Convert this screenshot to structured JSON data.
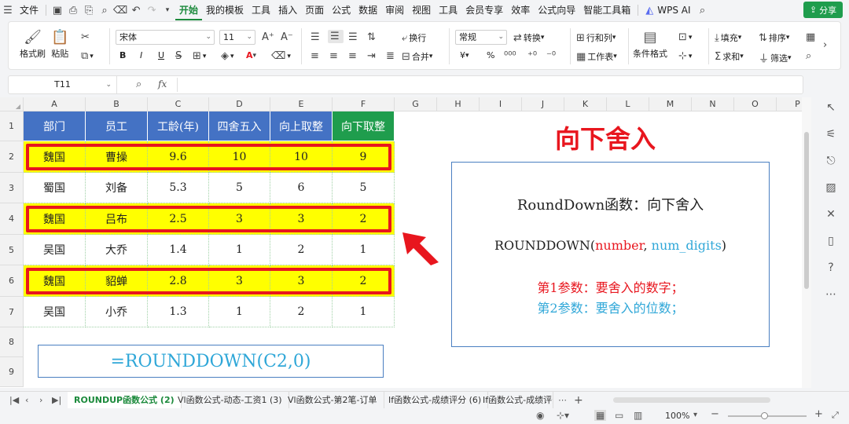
{
  "menubar": {
    "file": "文件",
    "tabs": [
      "开始",
      "我的模板",
      "工具",
      "插入",
      "页面",
      "公式",
      "数据",
      "审阅",
      "视图",
      "工具",
      "会员专享",
      "效率",
      "公式向导",
      "智能工具箱"
    ],
    "wps_ai": "WPS AI",
    "share": "分享"
  },
  "ribbon": {
    "format_painter": "格式刷",
    "paste": "粘贴",
    "font_name": "宋体",
    "font_size": "11",
    "bold": "B",
    "italic": "I",
    "underline": "U",
    "wrap": "换行",
    "merge": "合并",
    "number_format": "常规",
    "convert": "转换",
    "row_col": "行和列",
    "worksheet": "工作表",
    "cond_format": "条件格式",
    "fill": "填充",
    "sort": "排序",
    "sum": "求和",
    "filter": "筛选",
    "currency": "¥",
    "percent": "%"
  },
  "formula_bar": {
    "name_box": "T11",
    "fx": "fx"
  },
  "columns": [
    "A",
    "B",
    "C",
    "D",
    "E",
    "F",
    "G",
    "H",
    "I",
    "J",
    "K",
    "L",
    "M",
    "N",
    "O",
    "P"
  ],
  "rows": [
    "1",
    "2",
    "3",
    "4",
    "5",
    "6",
    "7",
    "8",
    "9"
  ],
  "table": {
    "headers": [
      "部门",
      "员工",
      "工龄(年)",
      "四舍五入",
      "向上取整",
      "向下取整"
    ],
    "data": [
      [
        "魏国",
        "曹操",
        "9.6",
        "10",
        "10",
        "9"
      ],
      [
        "蜀国",
        "刘备",
        "5.3",
        "5",
        "6",
        "5"
      ],
      [
        "魏国",
        "吕布",
        "2.5",
        "3",
        "3",
        "2"
      ],
      [
        "吴国",
        "大乔",
        "1.4",
        "1",
        "2",
        "1"
      ],
      [
        "魏国",
        "貂蝉",
        "2.8",
        "3",
        "3",
        "2"
      ],
      [
        "吴国",
        "小乔",
        "1.3",
        "1",
        "2",
        "1"
      ]
    ],
    "highlighted_rows": [
      0,
      2,
      4
    ]
  },
  "annotation": {
    "title": "向下舍入",
    "line1": "RoundDown函数：向下舍入",
    "fn_name": "ROUNDDOWN(",
    "arg1": "number",
    "comma": ", ",
    "arg2": "num_digits",
    "close": ")",
    "param1": "第1参数：要舍入的数字；",
    "param2": "第2参数：要舍入的位数；",
    "formula": "=ROUNDDOWN(C2,0)"
  },
  "sheet_tabs": [
    "ROUNDUP函数公式 (2)",
    "Vl函数公式-动态-工资1 (3)",
    "Vl函数公式-第2笔-订单",
    "If函数公式-成绩评分 (6)",
    "If函数公式-成绩评分"
  ],
  "status": {
    "zoom": "100%"
  },
  "colors": {
    "accent": "#1f9d4d",
    "header_blue": "#4472c4",
    "highlight": "#ffff00",
    "red": "#e8161e",
    "cyan": "#2fa7d8"
  }
}
